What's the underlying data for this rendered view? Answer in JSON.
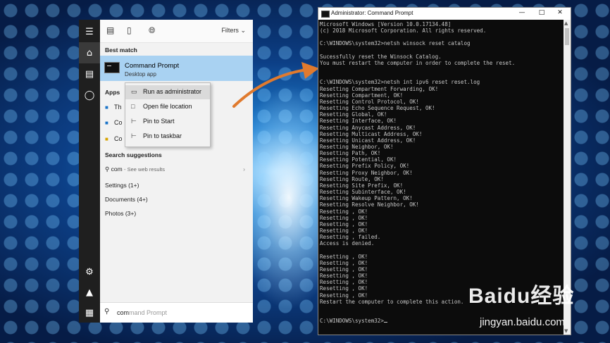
{
  "start_menu": {
    "top_bar": {
      "filters_label": "Filters"
    },
    "best_match": {
      "heading": "Best match",
      "title": "Command Prompt",
      "subtitle": "Desktop app"
    },
    "apps": {
      "heading": "Apps",
      "items": [
        "Th",
        "Co",
        "Co"
      ]
    },
    "search_suggestions": {
      "heading": "Search suggestions",
      "query": "com",
      "hint": "- See web results"
    },
    "categories": [
      "Settings (1+)",
      "Documents (4+)",
      "Photos (3+)"
    ],
    "search_box": {
      "typed": "com",
      "completion": "mand Prompt"
    }
  },
  "context_menu": {
    "items": [
      "Run as administrator",
      "Open file location",
      "Pin to Start",
      "Pin to taskbar"
    ]
  },
  "console_window": {
    "title": "Administrator: Command Prompt",
    "output": "Microsoft Windows [Version 10.0.17134.48]\n(c) 2018 Microsoft Corporation. All rights reserved.\n\nC:\\WINDOWS\\system32>netsh winsock reset catalog\n\nSucessfully reset the Winsock Catalog.\nYou must restart the computer in order to complete the reset.\n\n\nC:\\WINDOWS\\system32>netsh int ipv6 reset reset.log\nResetting Compartment Forwarding, OK!\nResetting Compartment, OK!\nResetting Control Protocol, OK!\nResetting Echo Sequence Request, OK!\nResetting Global, OK!\nResetting Interface, OK!\nResetting Anycast Address, OK!\nResetting Multicast Address, OK!\nResetting Unicast Address, OK!\nResetting Neighbor, OK!\nResetting Path, OK!\nResetting Potential, OK!\nResetting Prefix Policy, OK!\nResetting Proxy Neighbor, OK!\nResetting Route, OK!\nResetting Site Prefix, OK!\nResetting Subinterface, OK!\nResetting Wakeup Pattern, OK!\nResetting Resolve Neighbor, OK!\nResetting , OK!\nResetting , OK!\nResetting , OK!\nResetting , OK!\nResetting , failed.\nAccess is denied.\n\nResetting , OK!\nResetting , OK!\nResetting , OK!\nResetting , OK!\nResetting , OK!\nResetting , OK!\nResetting , OK!\nRestart the computer to complete this action.\n\n\nC:\\WINDOWS\\system32>"
  },
  "watermark": {
    "logo_text": "Baidu经验",
    "url": "jingyan.baidu.com"
  },
  "colors": {
    "highlight": "#a9d2f2",
    "console_bg": "#0c0c0c",
    "console_text": "#c8c8c8",
    "arrow": "#e07a2e"
  }
}
